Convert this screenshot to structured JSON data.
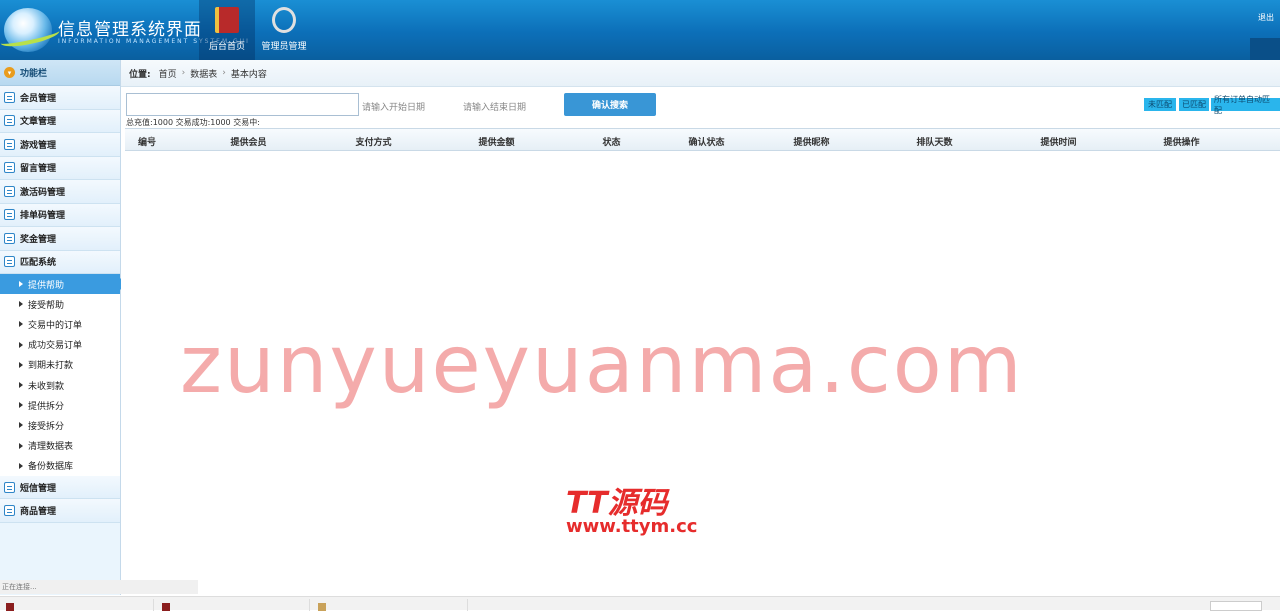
{
  "header": {
    "title": "信息管理系统界面",
    "subtitle": "INFORMATION MANAGEMENT SYSTEM GUI",
    "nav": [
      {
        "label": "后台首页",
        "icon": "book-icon",
        "active": true
      },
      {
        "label": "管理员管理",
        "icon": "tools-icon",
        "active": false
      }
    ],
    "logout": "退出"
  },
  "sidebar": {
    "title": "功能栏",
    "groups": [
      {
        "label": "会员管理"
      },
      {
        "label": "文章管理"
      },
      {
        "label": "游戏管理"
      },
      {
        "label": "留言管理"
      },
      {
        "label": "激活码管理"
      },
      {
        "label": "排单码管理"
      },
      {
        "label": "奖金管理"
      },
      {
        "label": "匹配系统"
      }
    ],
    "sub_items": [
      {
        "label": "提供帮助",
        "active": true
      },
      {
        "label": "接受帮助"
      },
      {
        "label": "交易中的订单"
      },
      {
        "label": "成功交易订单"
      },
      {
        "label": "到期未打款"
      },
      {
        "label": "未收到款"
      },
      {
        "label": "提供拆分"
      },
      {
        "label": "接受拆分"
      },
      {
        "label": "清理数据表"
      },
      {
        "label": "备份数据库"
      }
    ],
    "groups_after": [
      {
        "label": "短信管理"
      },
      {
        "label": "商品管理"
      }
    ]
  },
  "breadcrumb": {
    "label": "位置:",
    "items": [
      "首页",
      "数据表",
      "基本内容"
    ]
  },
  "search": {
    "start_placeholder": "请输入开始日期",
    "end_placeholder": "请输入结束日期",
    "confirm_label": "确认搜索",
    "buttons": [
      "未匹配",
      "已匹配",
      "所有订单自动匹配"
    ]
  },
  "stats": "总充值:1000 交易成功:1000 交易中:",
  "table": {
    "headers": [
      "编号",
      "提供会员",
      "支付方式",
      "提供金额",
      "状态",
      "确认状态",
      "提供昵称",
      "排队天数",
      "提供时间",
      "提供操作"
    ],
    "sort_indicator": "◇"
  },
  "watermarks": {
    "main": "zunyueyuanma.com",
    "logo": "TT源码",
    "url": "www.ttym.cc"
  },
  "status_bar": "正在连接..."
}
